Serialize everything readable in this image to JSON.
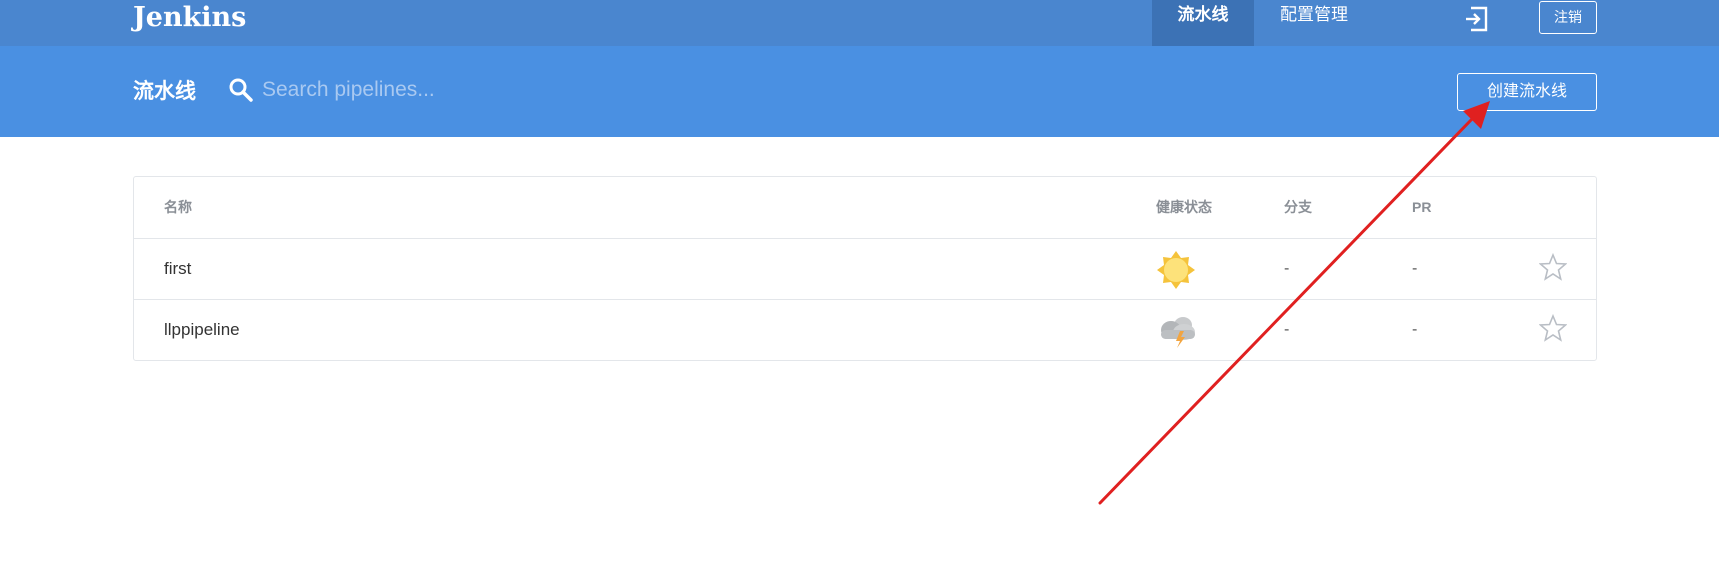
{
  "app": {
    "brand": "Jenkins"
  },
  "topnav": {
    "tabs": [
      {
        "label": "流水线",
        "active": true
      },
      {
        "label": "配置管理",
        "active": false
      }
    ],
    "logout_icon": "logout-icon",
    "logout_label": "注销"
  },
  "subheader": {
    "title": "流水线",
    "search": {
      "placeholder": "Search pipelines...",
      "value": ""
    },
    "create_label": "创建流水线"
  },
  "table": {
    "columns": [
      "名称",
      "健康状态",
      "分支",
      "PR"
    ],
    "rows": [
      {
        "name": "first",
        "health": "sunny-icon",
        "branches": "-",
        "prs": "-",
        "favorite": false
      },
      {
        "name": "llppipeline",
        "health": "stormy-icon",
        "branches": "-",
        "prs": "-",
        "favorite": false
      }
    ]
  },
  "colors": {
    "topbar": "#4a86cf",
    "active_tab": "#3c72b5",
    "subheader": "#4a90e2",
    "annotation_arrow": "#e02020"
  }
}
